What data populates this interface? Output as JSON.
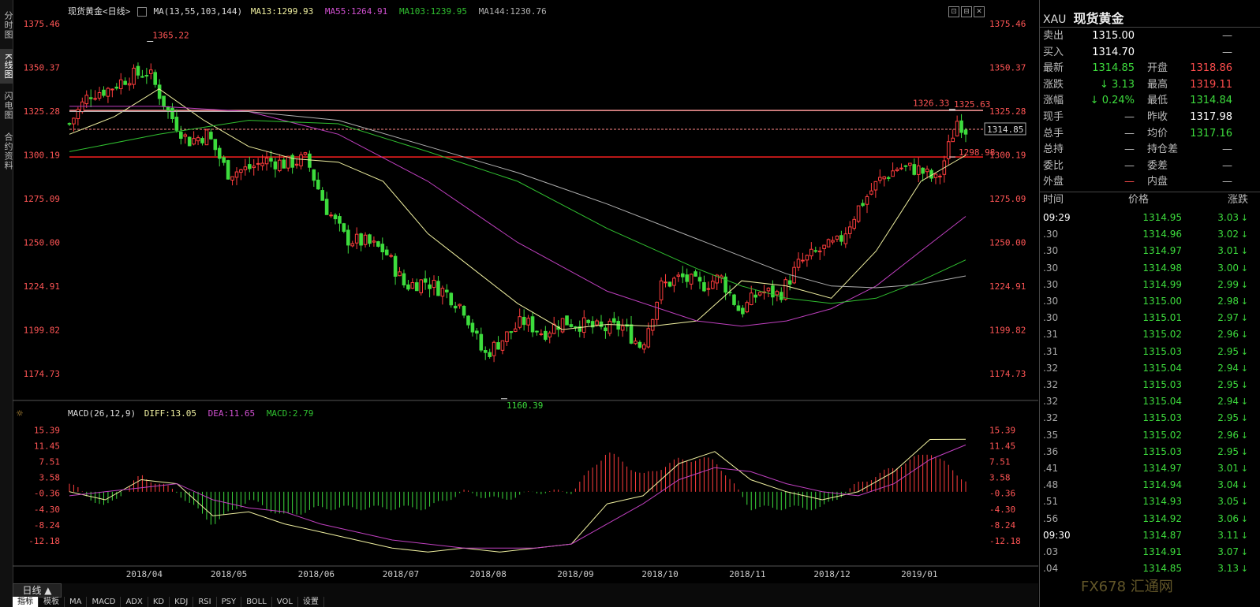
{
  "left_tabs": [
    {
      "label": "分时图",
      "active": false
    },
    {
      "label": "K线图",
      "active": true
    },
    {
      "label": "闪电图",
      "active": false
    },
    {
      "label": "合约资料",
      "active": false
    }
  ],
  "main_legend": {
    "name": "现货黄金<日线>",
    "ma_label": "MA(13,55,103,144)",
    "ma13": "MA13:1299.93",
    "ma55": "MA55:1264.91",
    "ma103": "MA103:1239.95",
    "ma144": "MA144:1230.76"
  },
  "macd_legend": {
    "label": "MACD(26,12,9)",
    "diff": "DIFF:13.05",
    "dea": "DEA:11.65",
    "macd": "MACD:2.79"
  },
  "colors": {
    "up": "#ff3d3d",
    "down": "#3ddc3d",
    "ma13": "#f0f0a0",
    "ma55": "#c040c0",
    "ma103": "#30c030",
    "ma144": "#b0b0b0",
    "diff": "#f0f0a0",
    "dea": "#c040c0"
  },
  "chart_data": [
    {
      "type": "candlestick",
      "name": "现货黄金<日线>",
      "x_labels": [
        "2018/04",
        "2018/05",
        "2018/06",
        "2018/07",
        "2018/08",
        "2018/09",
        "2018/10",
        "2018/11",
        "2018/12",
        "2019/01"
      ],
      "y_ticks": [
        1375.46,
        1350.37,
        1325.28,
        1300.19,
        1275.09,
        1250.0,
        1224.91,
        1199.82,
        1174.73
      ],
      "ylim": [
        1163.0,
        1379.0
      ],
      "annotations": [
        {
          "text": "1365.22",
          "value": 1365.22,
          "date": "2018/04"
        },
        {
          "text": "1160.39",
          "value": 1160.39,
          "date": "2018/08"
        },
        {
          "text": "1326.33",
          "value": 1326.33,
          "date": "2019/01"
        },
        {
          "text": "1325.63",
          "value": 1325.63,
          "date": "2019/01"
        },
        {
          "text": "1298.98",
          "value": 1298.98,
          "date": "2019/01"
        }
      ],
      "horizontal_lines": [
        {
          "value": 1325.63,
          "color": "#ff9a9a"
        },
        {
          "value": 1298.98,
          "color": "#ff2020"
        }
      ],
      "current_price_line": {
        "value": 1314.85,
        "label": "1314.85"
      },
      "close_path": [
        {
          "date": "2018/03/20",
          "close": 1318
        },
        {
          "date": "2018/03/27",
          "close": 1335
        },
        {
          "date": "2018/04/03",
          "close": 1338
        },
        {
          "date": "2018/04/10",
          "close": 1345
        },
        {
          "date": "2018/04/17",
          "close": 1348
        },
        {
          "date": "2018/04/24",
          "close": 1325
        },
        {
          "date": "2018/05/01",
          "close": 1308
        },
        {
          "date": "2018/05/08",
          "close": 1312
        },
        {
          "date": "2018/05/15",
          "close": 1290
        },
        {
          "date": "2018/05/22",
          "close": 1292
        },
        {
          "date": "2018/05/29",
          "close": 1297
        },
        {
          "date": "2018/06/05",
          "close": 1295
        },
        {
          "date": "2018/06/12",
          "close": 1298
        },
        {
          "date": "2018/06/19",
          "close": 1270
        },
        {
          "date": "2018/06/26",
          "close": 1252
        },
        {
          "date": "2018/07/03",
          "close": 1250
        },
        {
          "date": "2018/07/10",
          "close": 1245
        },
        {
          "date": "2018/07/17",
          "close": 1225
        },
        {
          "date": "2018/07/24",
          "close": 1228
        },
        {
          "date": "2018/07/31",
          "close": 1222
        },
        {
          "date": "2018/08/07",
          "close": 1212
        },
        {
          "date": "2018/08/14",
          "close": 1185
        },
        {
          "date": "2018/08/21",
          "close": 1195
        },
        {
          "date": "2018/08/28",
          "close": 1205
        },
        {
          "date": "2018/09/04",
          "close": 1198
        },
        {
          "date": "2018/09/11",
          "close": 1205
        },
        {
          "date": "2018/09/18",
          "close": 1203
        },
        {
          "date": "2018/09/25",
          "close": 1200
        },
        {
          "date": "2018/10/02",
          "close": 1202
        },
        {
          "date": "2018/10/09",
          "close": 1190
        },
        {
          "date": "2018/10/16",
          "close": 1225
        },
        {
          "date": "2018/10/23",
          "close": 1230
        },
        {
          "date": "2018/10/30",
          "close": 1225
        },
        {
          "date": "2018/11/06",
          "close": 1230
        },
        {
          "date": "2018/11/13",
          "close": 1210
        },
        {
          "date": "2018/11/20",
          "close": 1222
        },
        {
          "date": "2018/11/27",
          "close": 1220
        },
        {
          "date": "2018/12/04",
          "close": 1238
        },
        {
          "date": "2018/12/11",
          "close": 1245
        },
        {
          "date": "2018/12/18",
          "close": 1250
        },
        {
          "date": "2018/12/25",
          "close": 1270
        },
        {
          "date": "2019/01/01",
          "close": 1285
        },
        {
          "date": "2019/01/08",
          "close": 1293
        },
        {
          "date": "2019/01/15",
          "close": 1292
        },
        {
          "date": "2019/01/22",
          "close": 1285
        },
        {
          "date": "2019/01/29",
          "close": 1320
        },
        {
          "date": "2019/02/01",
          "close": 1314.85
        }
      ],
      "series": [
        {
          "name": "MA13",
          "points": [
            [
              0,
              1312
            ],
            [
              0.05,
              1322
            ],
            [
              0.1,
              1338
            ],
            [
              0.15,
              1320
            ],
            [
              0.2,
              1305
            ],
            [
              0.25,
              1298
            ],
            [
              0.3,
              1296
            ],
            [
              0.35,
              1285
            ],
            [
              0.4,
              1255
            ],
            [
              0.45,
              1235
            ],
            [
              0.5,
              1215
            ],
            [
              0.55,
              1200
            ],
            [
              0.6,
              1203
            ],
            [
              0.65,
              1202
            ],
            [
              0.7,
              1205
            ],
            [
              0.75,
              1228
            ],
            [
              0.8,
              1225
            ],
            [
              0.85,
              1218
            ],
            [
              0.9,
              1245
            ],
            [
              0.95,
              1285
            ],
            [
              1.0,
              1299.93
            ]
          ]
        },
        {
          "name": "MA55",
          "points": [
            [
              0,
              1328
            ],
            [
              0.1,
              1328
            ],
            [
              0.2,
              1325
            ],
            [
              0.3,
              1312
            ],
            [
              0.4,
              1285
            ],
            [
              0.5,
              1250
            ],
            [
              0.6,
              1222
            ],
            [
              0.7,
              1205
            ],
            [
              0.75,
              1202
            ],
            [
              0.8,
              1205
            ],
            [
              0.85,
              1212
            ],
            [
              0.9,
              1225
            ],
            [
              0.95,
              1245
            ],
            [
              1.0,
              1264.91
            ]
          ]
        },
        {
          "name": "MA103",
          "points": [
            [
              0,
              1302
            ],
            [
              0.1,
              1312
            ],
            [
              0.2,
              1320
            ],
            [
              0.3,
              1318
            ],
            [
              0.4,
              1302
            ],
            [
              0.5,
              1285
            ],
            [
              0.6,
              1258
            ],
            [
              0.7,
              1235
            ],
            [
              0.75,
              1225
            ],
            [
              0.8,
              1218
            ],
            [
              0.85,
              1215
            ],
            [
              0.9,
              1218
            ],
            [
              0.95,
              1228
            ],
            [
              1.0,
              1239.95
            ]
          ]
        },
        {
          "name": "MA144",
          "points": [
            [
              0,
              1325
            ],
            [
              0.2,
              1325
            ],
            [
              0.3,
              1320
            ],
            [
              0.4,
              1305
            ],
            [
              0.5,
              1290
            ],
            [
              0.6,
              1272
            ],
            [
              0.7,
              1252
            ],
            [
              0.75,
              1242
            ],
            [
              0.8,
              1232
            ],
            [
              0.85,
              1225
            ],
            [
              0.9,
              1224
            ],
            [
              0.95,
              1226
            ],
            [
              1.0,
              1230.76
            ]
          ]
        }
      ]
    },
    {
      "type": "macd",
      "name": "MACD(26,12,9)",
      "y_ticks": [
        15.39,
        11.45,
        7.51,
        3.58,
        -0.36,
        -4.3,
        -8.24,
        -12.18
      ],
      "ylim": [
        -16.5,
        18.0
      ],
      "diff": [
        [
          0,
          0
        ],
        [
          0.04,
          -2
        ],
        [
          0.08,
          3
        ],
        [
          0.12,
          2
        ],
        [
          0.16,
          -6
        ],
        [
          0.2,
          -5
        ],
        [
          0.24,
          -8
        ],
        [
          0.28,
          -10
        ],
        [
          0.32,
          -12
        ],
        [
          0.36,
          -14
        ],
        [
          0.4,
          -15
        ],
        [
          0.44,
          -14
        ],
        [
          0.48,
          -15
        ],
        [
          0.52,
          -14
        ],
        [
          0.56,
          -13
        ],
        [
          0.6,
          -3
        ],
        [
          0.64,
          -1
        ],
        [
          0.68,
          7
        ],
        [
          0.72,
          10
        ],
        [
          0.76,
          3
        ],
        [
          0.8,
          0
        ],
        [
          0.84,
          -2
        ],
        [
          0.88,
          0
        ],
        [
          0.92,
          5
        ],
        [
          0.96,
          13
        ],
        [
          1.0,
          13.05
        ]
      ],
      "dea": [
        [
          0,
          -1
        ],
        [
          0.04,
          0
        ],
        [
          0.08,
          1
        ],
        [
          0.12,
          2
        ],
        [
          0.16,
          -2
        ],
        [
          0.2,
          -4
        ],
        [
          0.24,
          -5
        ],
        [
          0.28,
          -8
        ],
        [
          0.32,
          -10
        ],
        [
          0.36,
          -12
        ],
        [
          0.4,
          -13
        ],
        [
          0.44,
          -14
        ],
        [
          0.48,
          -14
        ],
        [
          0.52,
          -14
        ],
        [
          0.56,
          -13
        ],
        [
          0.6,
          -8
        ],
        [
          0.64,
          -3
        ],
        [
          0.68,
          3
        ],
        [
          0.72,
          6
        ],
        [
          0.76,
          5
        ],
        [
          0.8,
          2
        ],
        [
          0.84,
          0
        ],
        [
          0.88,
          -1
        ],
        [
          0.92,
          2
        ],
        [
          0.96,
          8
        ],
        [
          1.0,
          11.65
        ]
      ],
      "last_macd": 2.79
    }
  ],
  "right_panel": {
    "code": "XAU",
    "name": "现货黄金",
    "quotes": [
      {
        "l1": "卖出",
        "v1": "1315.00",
        "c1": "#ffffff",
        "l2": "",
        "v2": "—",
        "c2": "#bbbbbb"
      },
      {
        "l1": "买入",
        "v1": "1314.70",
        "c1": "#ffffff",
        "l2": "",
        "v2": "—",
        "c2": "#bbbbbb"
      },
      {
        "l1": "最新",
        "v1": "1314.85",
        "c1": "#3ddc3d",
        "l2": "开盘",
        "v2": "1318.86",
        "c2": "#ff4d4d"
      },
      {
        "l1": "涨跌",
        "v1": "↓ 3.13",
        "c1": "#3ddc3d",
        "l2": "最高",
        "v2": "1319.11",
        "c2": "#ff4d4d"
      },
      {
        "l1": "涨幅",
        "v1": "↓ 0.24%",
        "c1": "#3ddc3d",
        "l2": "最低",
        "v2": "1314.84",
        "c2": "#3ddc3d"
      },
      {
        "l1": "现手",
        "v1": "—",
        "c1": "#bbbbbb",
        "l2": "昨收",
        "v2": "1317.98",
        "c2": "#ffffff"
      },
      {
        "l1": "总手",
        "v1": "—",
        "c1": "#bbbbbb",
        "l2": "均价",
        "v2": "1317.16",
        "c2": "#3ddc3d"
      },
      {
        "l1": "总持",
        "v1": "—",
        "c1": "#bbbbbb",
        "l2": "持仓差",
        "v2": "—",
        "c2": "#bbbbbb"
      },
      {
        "l1": "委比",
        "v1": "—",
        "c1": "#bbbbbb",
        "l2": "委差",
        "v2": "—",
        "c2": "#bbbbbb"
      },
      {
        "l1": "外盘",
        "v1": "—",
        "c1": "#ff4d4d",
        "l2": "内盘",
        "v2": "—",
        "c2": "#bbbbbb"
      }
    ],
    "tick_header": {
      "time": "时间",
      "price": "价格",
      "change": "涨跌"
    },
    "ticks": [
      {
        "time": "09:29",
        "price": "1314.95",
        "change": "3.03"
      },
      {
        "time": ".30",
        "price": "1314.96",
        "change": "3.02"
      },
      {
        "time": ".30",
        "price": "1314.97",
        "change": "3.01"
      },
      {
        "time": ".30",
        "price": "1314.98",
        "change": "3.00"
      },
      {
        "time": ".30",
        "price": "1314.99",
        "change": "2.99"
      },
      {
        "time": ".30",
        "price": "1315.00",
        "change": "2.98"
      },
      {
        "time": ".30",
        "price": "1315.01",
        "change": "2.97"
      },
      {
        "time": ".31",
        "price": "1315.02",
        "change": "2.96"
      },
      {
        "time": ".31",
        "price": "1315.03",
        "change": "2.95"
      },
      {
        "time": ".32",
        "price": "1315.04",
        "change": "2.94"
      },
      {
        "time": ".32",
        "price": "1315.03",
        "change": "2.95"
      },
      {
        "time": ".32",
        "price": "1315.04",
        "change": "2.94"
      },
      {
        "time": ".32",
        "price": "1315.03",
        "change": "2.95"
      },
      {
        "time": ".35",
        "price": "1315.02",
        "change": "2.96"
      },
      {
        "time": ".36",
        "price": "1315.03",
        "change": "2.95"
      },
      {
        "time": ".41",
        "price": "1314.97",
        "change": "3.01"
      },
      {
        "time": ".48",
        "price": "1314.94",
        "change": "3.04"
      },
      {
        "time": ".51",
        "price": "1314.93",
        "change": "3.05"
      },
      {
        "time": ".56",
        "price": "1314.92",
        "change": "3.06"
      },
      {
        "time": "09:30",
        "price": "1314.87",
        "change": "3.11"
      },
      {
        "time": ".03",
        "price": "1314.91",
        "change": "3.07"
      },
      {
        "time": ".04",
        "price": "1314.85",
        "change": "3.13"
      }
    ]
  },
  "bottom_bar": {
    "period": "日线 ▲",
    "tabs": [
      "指标",
      "模板",
      "MA",
      "MACD",
      "ADX",
      "KD",
      "KDJ",
      "RSI",
      "PSY",
      "BOLL",
      "VOL",
      "设置"
    ]
  },
  "watermark": "FX678 汇通网"
}
